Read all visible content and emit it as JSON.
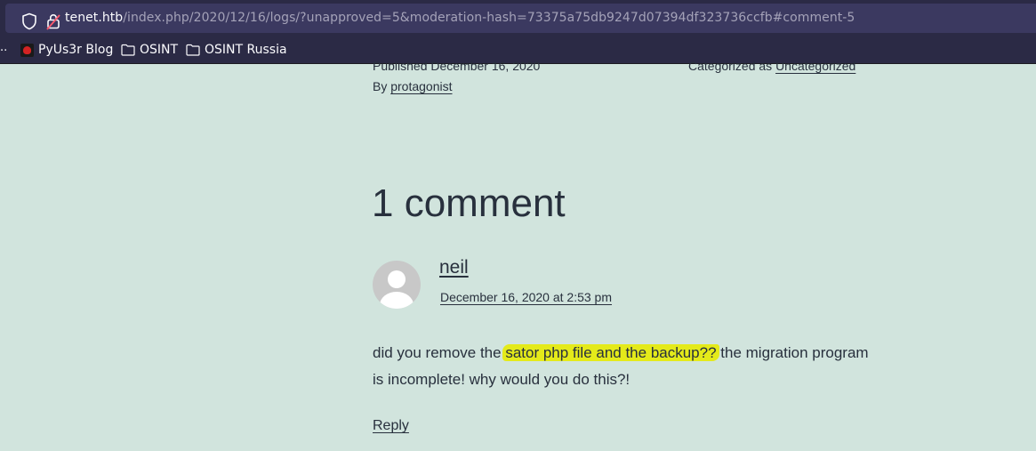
{
  "browser": {
    "url_host": "tenet.htb",
    "url_path": "/index.php/2020/12/16/logs/?unapproved=5&moderation-hash=73375a75db9247d07394df323736ccfb#comment-5",
    "bookmarks_overflow": "..",
    "bookmarks": [
      {
        "label": "PyUs3r Blog",
        "icon": "favicon-icon"
      },
      {
        "label": "OSINT",
        "icon": "folder-icon"
      },
      {
        "label": "OSINT Russia",
        "icon": "folder-icon"
      }
    ]
  },
  "post_meta": {
    "published": "Published December 16, 2020",
    "by_prefix": "By ",
    "author": "protagonist",
    "categorized_prefix": "Categorized as ",
    "category": "Uncategorized"
  },
  "comments": {
    "title": "1 comment",
    "items": [
      {
        "author": "neil",
        "date": "December 16, 2020 at 2:53 pm",
        "text_before": "did you remove the ",
        "text_highlight": "sator php file and the backup??",
        "text_after": " the migration program is incomplete! why would you do this?!",
        "reply_label": "Reply"
      }
    ]
  },
  "colors": {
    "page_background": "#d1e4dd",
    "text": "#28303d",
    "chrome_background": "#2b2a45",
    "highlight": "#e4ea1a"
  }
}
